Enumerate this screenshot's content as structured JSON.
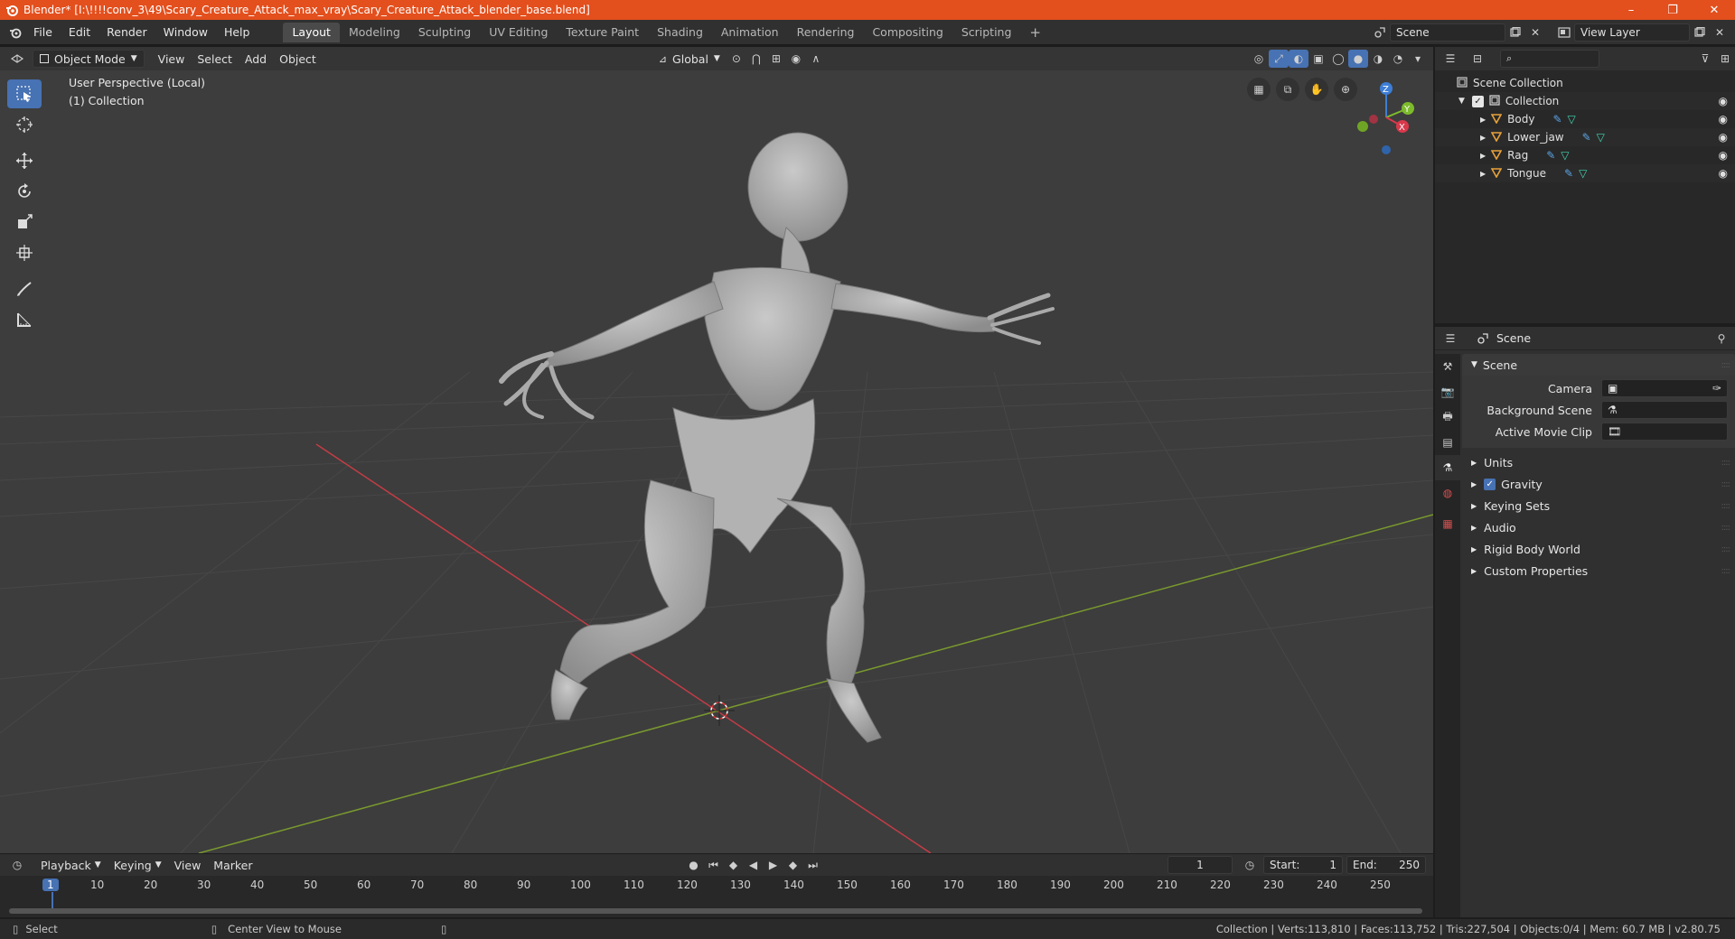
{
  "window": {
    "title": "Blender* [I:\\!!!!conv_3\\49\\Scary_Creature_Attack_max_vray\\Scary_Creature_Attack_blender_base.blend]",
    "minimize": "–",
    "maximize": "❐",
    "close": "✕"
  },
  "menu": [
    "File",
    "Edit",
    "Render",
    "Window",
    "Help"
  ],
  "workspaces": [
    "Layout",
    "Modeling",
    "Sculpting",
    "UV Editing",
    "Texture Paint",
    "Shading",
    "Animation",
    "Rendering",
    "Compositing",
    "Scripting"
  ],
  "workspace_add": "+",
  "scene_field": "Scene",
  "view_layer_field": "View Layer",
  "viewport": {
    "mode": "Object Mode",
    "menus": [
      "View",
      "Select",
      "Add",
      "Object"
    ],
    "orientation": "Global",
    "overlay_line1": "User Perspective (Local)",
    "overlay_line2": "(1) Collection",
    "gizmo": {
      "z": "Z",
      "y": "Y",
      "x": "X"
    }
  },
  "outliner": {
    "root": "Scene Collection",
    "collection": "Collection",
    "objects": [
      "Body",
      "Lower_jaw",
      "Rag",
      "Tongue"
    ]
  },
  "properties": {
    "context": "Scene",
    "panel_title": "Scene",
    "fields": [
      {
        "label": "Camera"
      },
      {
        "label": "Background Scene"
      },
      {
        "label": "Active Movie Clip"
      }
    ],
    "sections": [
      "Units",
      "Gravity",
      "Keying Sets",
      "Audio",
      "Rigid Body World",
      "Custom Properties"
    ]
  },
  "timeline": {
    "menus": [
      "Playback",
      "Keying",
      "View",
      "Marker"
    ],
    "current_frame": "1",
    "start_label": "Start:",
    "start": "1",
    "end_label": "End:",
    "end": "250",
    "ticks": [
      "1",
      "10",
      "20",
      "30",
      "40",
      "50",
      "60",
      "70",
      "80",
      "90",
      "100",
      "110",
      "120",
      "130",
      "140",
      "150",
      "160",
      "170",
      "180",
      "190",
      "200",
      "210",
      "220",
      "230",
      "240",
      "250"
    ]
  },
  "status": {
    "left_action": "Select",
    "mid_action": "Center View to Mouse",
    "stats": "Collection | Verts:113,810 | Faces:113,752 | Tris:227,504 | Objects:0/4 | Mem: 60.7 MB | v2.80.75"
  },
  "colors": {
    "titlebar": "#e34f1d",
    "accent": "#4772b3",
    "viewport_bg": "#3d3d3d",
    "x_axis": "#c43c46",
    "y_axis": "#7a9a2e",
    "mesh_icon": "#e8a23a",
    "modifier_icon": "#5aa5e6",
    "vertex_icon": "#43d4b0"
  }
}
